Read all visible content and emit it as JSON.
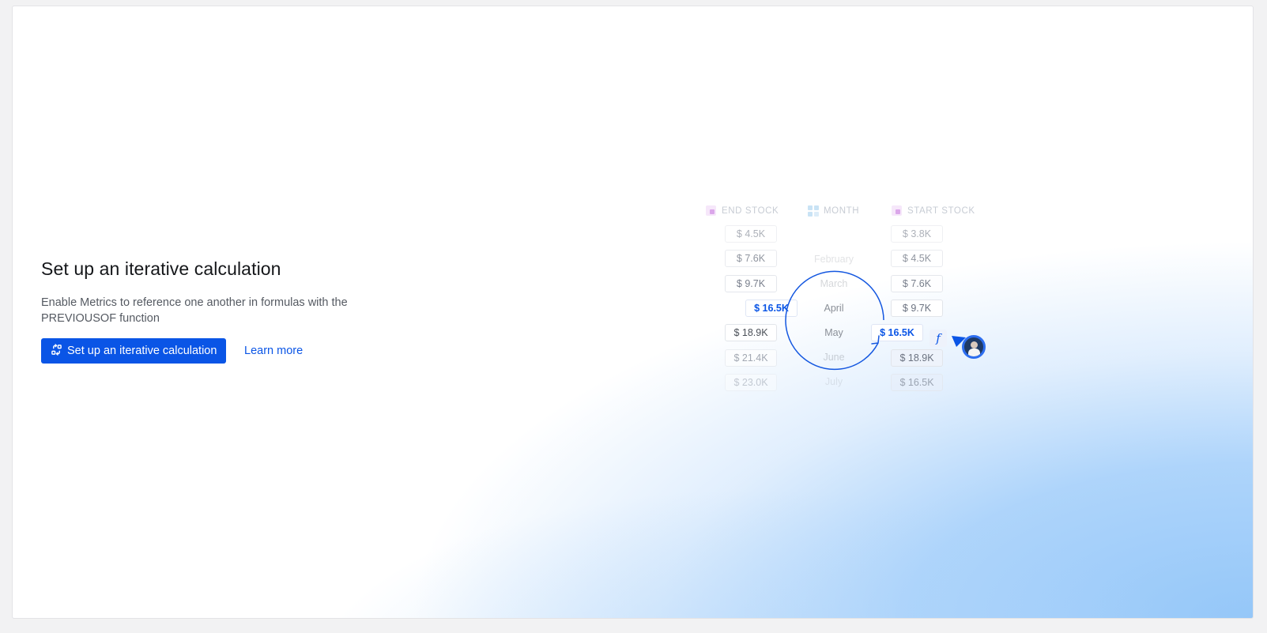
{
  "panel": {
    "title": "Set up an iterative calculation",
    "description": "Enable Metrics to reference one another in formulas with the PREVIOUSOF function",
    "primary_button_label": "Set up an iterative calculation",
    "learn_more_label": "Learn more"
  },
  "illustration": {
    "headers": {
      "end_stock": "END STOCK",
      "month": "MONTH",
      "start_stock": "START STOCK"
    },
    "end_stock_values": [
      "$ 4.5K",
      "$ 7.6K",
      "$ 9.7K",
      "$ 16.5K",
      "$ 18.9K",
      "$ 21.4K",
      "$ 23.0K"
    ],
    "months": [
      "",
      "February",
      "March",
      "April",
      "May",
      "June",
      "July"
    ],
    "start_stock_values": [
      "$ 3.8K",
      "$ 4.5K",
      "$ 7.6K",
      "$ 9.7K",
      "$ 16.5K",
      "$ 18.9K",
      "$ 16.5K"
    ],
    "formula_icon": "f",
    "icons": {
      "primary_button_icon": "loop-arrows-icon",
      "formula_icon": "function-icon",
      "cursor": "pointer-arrow-icon",
      "avatar": "user-avatar"
    },
    "colors": {
      "accent": "#0a55e6",
      "end_stock_header_icon": "#e9c6f2",
      "month_header_icon": "#b9dcf5",
      "start_stock_header_icon": "#e9c6f2"
    }
  }
}
